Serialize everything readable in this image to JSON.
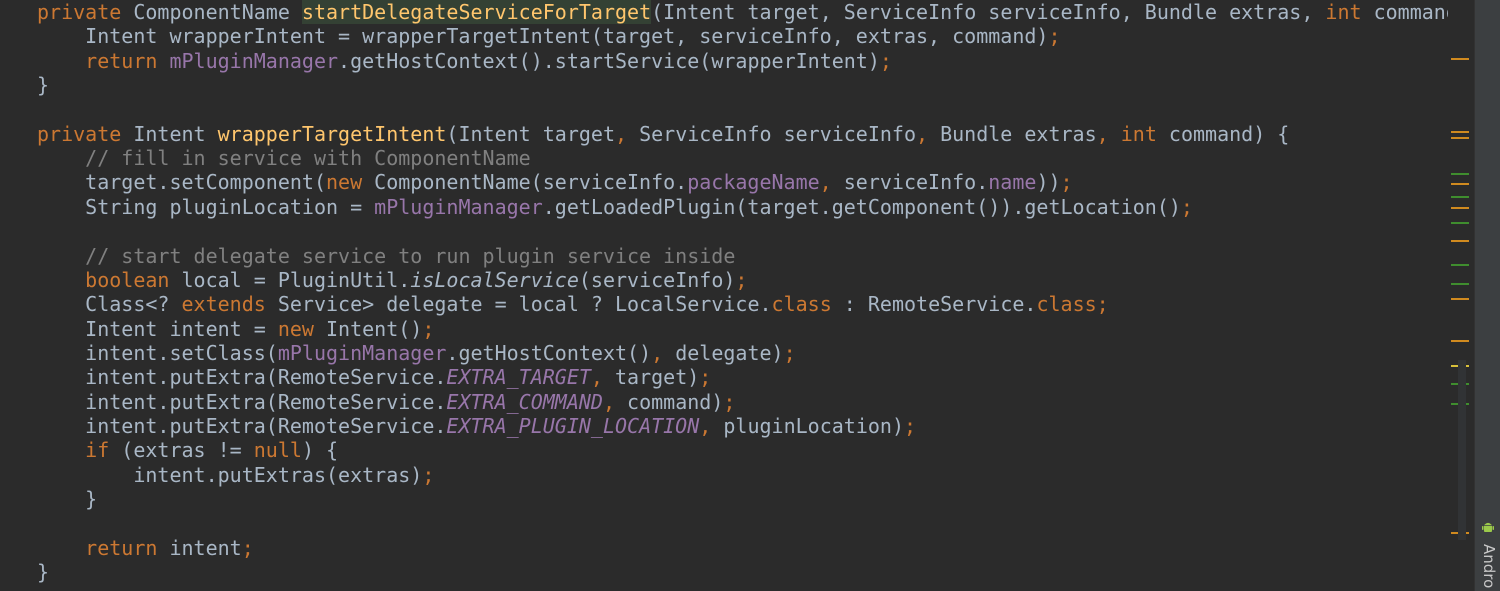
{
  "editor": {
    "lines": [
      [
        {
          "t": "private",
          "k": "kw"
        },
        {
          "t": " ComponentName "
        },
        {
          "caret": true
        },
        {
          "t": "startDelegateServiceForTarget",
          "k": "fn hl"
        },
        {
          "t": "(Intent target, ServiceInfo serviceInfo, Bundle extras, "
        },
        {
          "t": "int",
          "k": "kw"
        },
        {
          "t": " command"
        }
      ],
      [
        {
          "t": "    Intent wrapperIntent = wrapperTargetIntent(target, serviceInfo, extras, command)"
        },
        {
          "t": ";",
          "k": "kw"
        }
      ],
      [
        {
          "t": "    "
        },
        {
          "t": "return",
          "k": "kw"
        },
        {
          "t": " "
        },
        {
          "t": "mPluginManager",
          "k": "fd"
        },
        {
          "t": ".getHostContext().startService(wrapperIntent)"
        },
        {
          "t": ";",
          "k": "kw"
        }
      ],
      [
        {
          "t": "}"
        }
      ],
      [],
      [
        {
          "t": "private",
          "k": "kw"
        },
        {
          "t": " Intent "
        },
        {
          "t": "wrapperTargetIntent",
          "k": "fn"
        },
        {
          "t": "(Intent target"
        },
        {
          "t": ",",
          "k": "kw"
        },
        {
          "t": " ServiceInfo serviceInfo"
        },
        {
          "t": ",",
          "k": "kw"
        },
        {
          "t": " Bundle extras"
        },
        {
          "t": ",",
          "k": "kw"
        },
        {
          "t": " "
        },
        {
          "t": "int",
          "k": "kw"
        },
        {
          "t": " command) {"
        }
      ],
      [
        {
          "t": "    "
        },
        {
          "t": "// fill in service with ComponentName",
          "k": "cm"
        }
      ],
      [
        {
          "t": "    target.setComponent("
        },
        {
          "t": "new",
          "k": "kw"
        },
        {
          "t": " ComponentName(serviceInfo."
        },
        {
          "t": "packageName",
          "k": "fd"
        },
        {
          "t": ", ",
          "k": "kw"
        },
        {
          "t": "serviceInfo."
        },
        {
          "t": "name",
          "k": "fd"
        },
        {
          "t": "))"
        },
        {
          "t": ";",
          "k": "kw"
        }
      ],
      [
        {
          "t": "    String pluginLocation = "
        },
        {
          "t": "mPluginManager",
          "k": "fd"
        },
        {
          "t": ".getLoadedPlugin(target.getComponent()).getLocation()"
        },
        {
          "t": ";",
          "k": "kw"
        }
      ],
      [],
      [
        {
          "t": "    "
        },
        {
          "t": "// start delegate service to run plugin service inside",
          "k": "cm"
        }
      ],
      [
        {
          "t": "    "
        },
        {
          "t": "boolean",
          "k": "kw"
        },
        {
          "t": " local = PluginUtil."
        },
        {
          "t": "isLocalService",
          "k": "it"
        },
        {
          "t": "(serviceInfo)"
        },
        {
          "t": ";",
          "k": "kw"
        }
      ],
      [
        {
          "t": "    Class<? "
        },
        {
          "t": "extends",
          "k": "kw"
        },
        {
          "t": " Service> delegate = local ? LocalService."
        },
        {
          "t": "class",
          "k": "kw"
        },
        {
          "t": " : RemoteService."
        },
        {
          "t": "class",
          "k": "kw"
        },
        {
          "t": ";",
          "k": "kw"
        }
      ],
      [
        {
          "t": "    Intent intent = "
        },
        {
          "t": "new",
          "k": "kw"
        },
        {
          "t": " Intent()"
        },
        {
          "t": ";",
          "k": "kw"
        }
      ],
      [
        {
          "t": "    intent.setClass("
        },
        {
          "t": "mPluginManager",
          "k": "fd"
        },
        {
          "t": ".getHostContext()"
        },
        {
          "t": ",",
          "k": "kw"
        },
        {
          "t": " delegate)"
        },
        {
          "t": ";",
          "k": "kw"
        }
      ],
      [
        {
          "t": "    intent.putExtra(RemoteService."
        },
        {
          "t": "EXTRA_TARGET",
          "k": "st"
        },
        {
          "t": ",",
          "k": "kw"
        },
        {
          "t": " target)"
        },
        {
          "t": ";",
          "k": "kw"
        }
      ],
      [
        {
          "t": "    intent.putExtra(RemoteService."
        },
        {
          "t": "EXTRA_COMMAND",
          "k": "st"
        },
        {
          "t": ",",
          "k": "kw"
        },
        {
          "t": " command)"
        },
        {
          "t": ";",
          "k": "kw"
        }
      ],
      [
        {
          "t": "    intent.putExtra(RemoteService."
        },
        {
          "t": "EXTRA_PLUGIN_LOCATION",
          "k": "st"
        },
        {
          "t": ",",
          "k": "kw"
        },
        {
          "t": " pluginLocation)"
        },
        {
          "t": ";",
          "k": "kw"
        }
      ],
      [
        {
          "t": "    "
        },
        {
          "t": "if",
          "k": "kw"
        },
        {
          "t": " (extras != "
        },
        {
          "t": "null",
          "k": "kw"
        },
        {
          "t": ") {"
        }
      ],
      [
        {
          "t": "        intent.putExtras(extras)"
        },
        {
          "t": ";",
          "k": "kw"
        }
      ],
      [
        {
          "t": "    }"
        }
      ],
      [],
      [
        {
          "t": "    "
        },
        {
          "t": "return",
          "k": "kw"
        },
        {
          "t": " intent"
        },
        {
          "t": ";",
          "k": "kw"
        }
      ],
      [
        {
          "t": "}"
        }
      ]
    ]
  },
  "colors": {
    "background": "#2b2b2b",
    "keyword": "#cc7832",
    "method": "#ffc66d",
    "field": "#9876aa",
    "comment": "#808080",
    "text": "#a9b7c6"
  },
  "sidebar": {
    "android_label": "Andro",
    "android_icon": "android-icon"
  }
}
